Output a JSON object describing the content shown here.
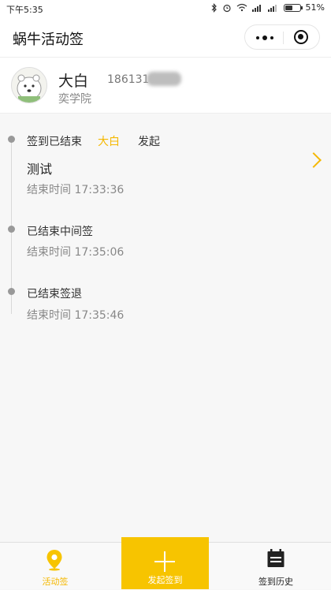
{
  "status": {
    "time": "下午5:35",
    "battery": "51%",
    "battery_level": 0.51
  },
  "nav": {
    "title": "蜗牛活动签"
  },
  "user": {
    "name": "大白",
    "phone": "186131",
    "school": "奕学院"
  },
  "timeline": {
    "first": {
      "status": "签到已结束",
      "initiator_name": "大白",
      "initiator_action": "发起",
      "title": "测试",
      "end_time": "结束时间 17:33:36"
    },
    "second": {
      "status": "已结束中间签",
      "end_time": "结束时间 17:35:06"
    },
    "third": {
      "status": "已结束签退",
      "end_time": "结束时间 17:35:46"
    }
  },
  "tabbar": {
    "items": [
      {
        "label": "活动签",
        "icon": "location-pin-icon",
        "active": true
      },
      {
        "label": "发起签到",
        "icon": "plus-icon"
      },
      {
        "label": "签到历史",
        "icon": "calendar-icon"
      }
    ]
  },
  "colors": {
    "accent": "#f7c400",
    "active_text": "#f5b800"
  }
}
